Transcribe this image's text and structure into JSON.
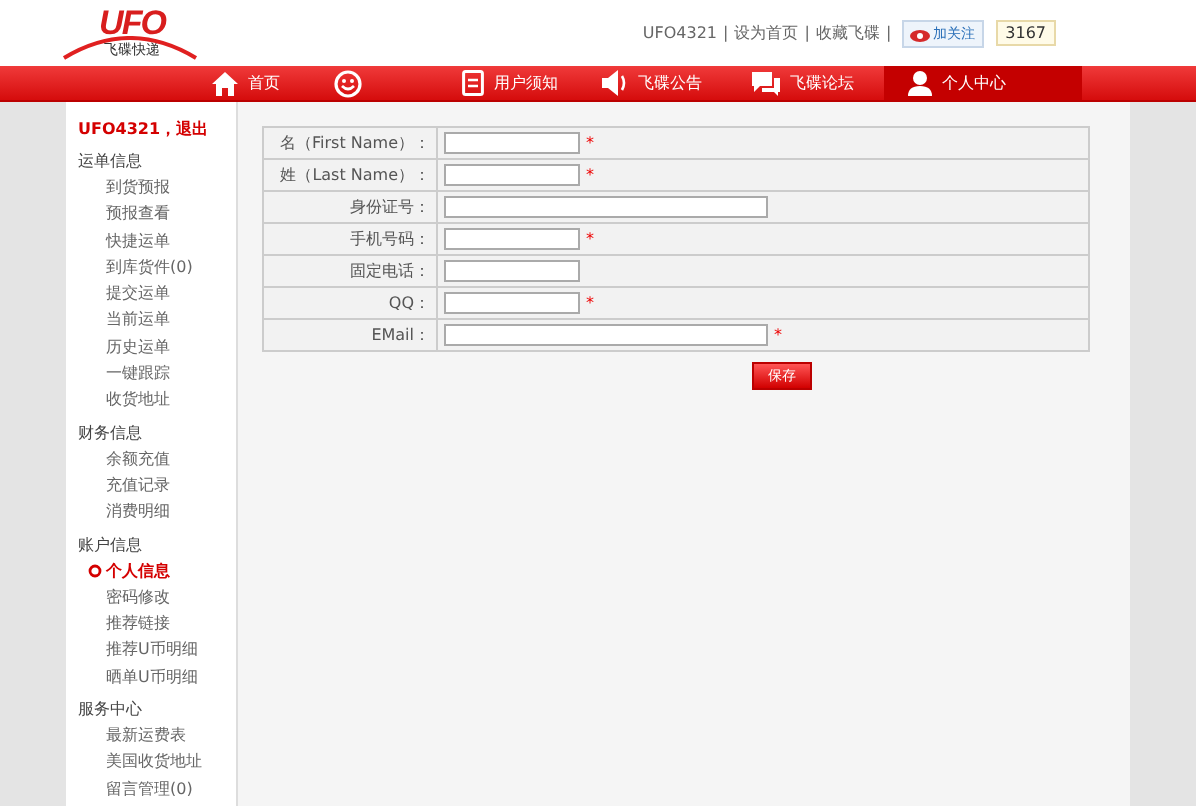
{
  "logo": {
    "mark": "UFO",
    "tagline": "飞碟快递"
  },
  "top_links": [
    "UFO4321",
    "设为首页",
    "收藏飞碟"
  ],
  "link_separator": "|",
  "follow": {
    "label": "加关注",
    "count": "3167"
  },
  "nav": [
    {
      "kind": "home",
      "label": "首页",
      "selected": false
    },
    {
      "kind": "smiley",
      "selected": false
    },
    {
      "kind": "doc",
      "label": "用户须知",
      "selected": false
    },
    {
      "kind": "speaker",
      "label": "飞碟公告",
      "selected": false
    },
    {
      "kind": "chat",
      "label": "飞碟论坛",
      "selected": false
    },
    {
      "kind": "user",
      "label": "个人中心",
      "selected": true
    }
  ],
  "sidebar": {
    "user": "UFO4321，",
    "logout": "退出",
    "groups": [
      {
        "title": "运单信息",
        "items": [
          {
            "label": "到货预报",
            "selected": false
          },
          {
            "label": "预报查看",
            "selected": false
          },
          {
            "label": "快捷运单",
            "selected": false
          },
          {
            "label": "到库货件(0)",
            "selected": false
          },
          {
            "label": "提交运单",
            "selected": false
          },
          {
            "label": "当前运单",
            "selected": false
          },
          {
            "label": "历史运单",
            "selected": false
          },
          {
            "label": "一键跟踪",
            "selected": false
          },
          {
            "label": "收货地址",
            "selected": false
          }
        ]
      },
      {
        "title": "财务信息",
        "items": [
          {
            "label": "余额充值",
            "selected": false
          },
          {
            "label": "充值记录",
            "selected": false
          },
          {
            "label": "消费明细",
            "selected": false
          }
        ]
      },
      {
        "title": "账户信息",
        "items": [
          {
            "label": "个人信息",
            "selected": true
          },
          {
            "label": "密码修改",
            "selected": false
          },
          {
            "label": "推荐链接",
            "selected": false
          },
          {
            "label": "推荐U币明细",
            "selected": false
          },
          {
            "label": "晒单U币明细",
            "selected": false
          }
        ]
      },
      {
        "title": "服务中心",
        "items": [
          {
            "label": "最新运费表",
            "selected": false
          },
          {
            "label": "美国收货地址",
            "selected": false
          },
          {
            "label": "留言管理(0)",
            "selected": false
          }
        ]
      }
    ]
  },
  "form": {
    "fields": [
      {
        "label": "名（First Name）：",
        "kind": "short",
        "required": true
      },
      {
        "label": "姓（Last Name）：",
        "kind": "short",
        "required": true
      },
      {
        "label": "身份证号：",
        "kind": "long",
        "required": false
      },
      {
        "label": "手机号码：",
        "kind": "short",
        "required": true
      },
      {
        "label": "固定电话：",
        "kind": "short",
        "required": false
      },
      {
        "label": "QQ：",
        "kind": "short",
        "required": true
      },
      {
        "label": "EMail：",
        "kind": "long",
        "required": true
      }
    ],
    "required_mark": "*",
    "save": "保存"
  }
}
